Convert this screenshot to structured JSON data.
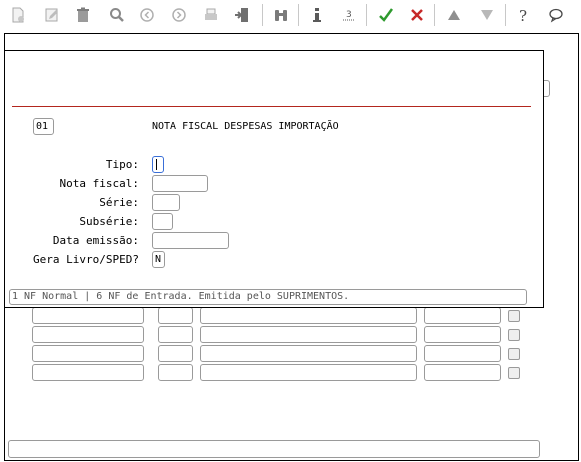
{
  "toolbar": {
    "icons": [
      "new-doc-icon",
      "edit-pencil-icon",
      "trash-icon",
      "search-icon",
      "prev-record-icon",
      "next-record-icon",
      "print-icon",
      "exit-door-icon",
      "binoculars-icon",
      "info-icon",
      "text-format-icon",
      "confirm-check-icon",
      "cancel-x-icon",
      "move-up-icon",
      "move-down-icon",
      "help-icon",
      "chat-icon"
    ]
  },
  "dialog": {
    "code": "01",
    "title": "NOTA FISCAL DESPESAS IMPORTAÇÃO",
    "fields": {
      "tipo_label": "Tipo:",
      "tipo_value": "",
      "nota_fiscal_label": "Nota fiscal:",
      "nota_fiscal_value": "",
      "serie_label": "Série:",
      "serie_value": "",
      "subserie_label": "Subsérie:",
      "subserie_value": "",
      "data_emissao_label": "Data emissão:",
      "data_emissao_value": "",
      "gera_livro_label": "Gera Livro/SPED?",
      "gera_livro_value": "N"
    },
    "status_text": "1 NF Normal | 6 NF de Entrada. Emitida pelo SUPRIMENTOS."
  },
  "colors": {
    "rule": "#b3261e",
    "confirm": "#2e9a2e",
    "cancel": "#c62828",
    "focus": "#3a6fd8"
  }
}
